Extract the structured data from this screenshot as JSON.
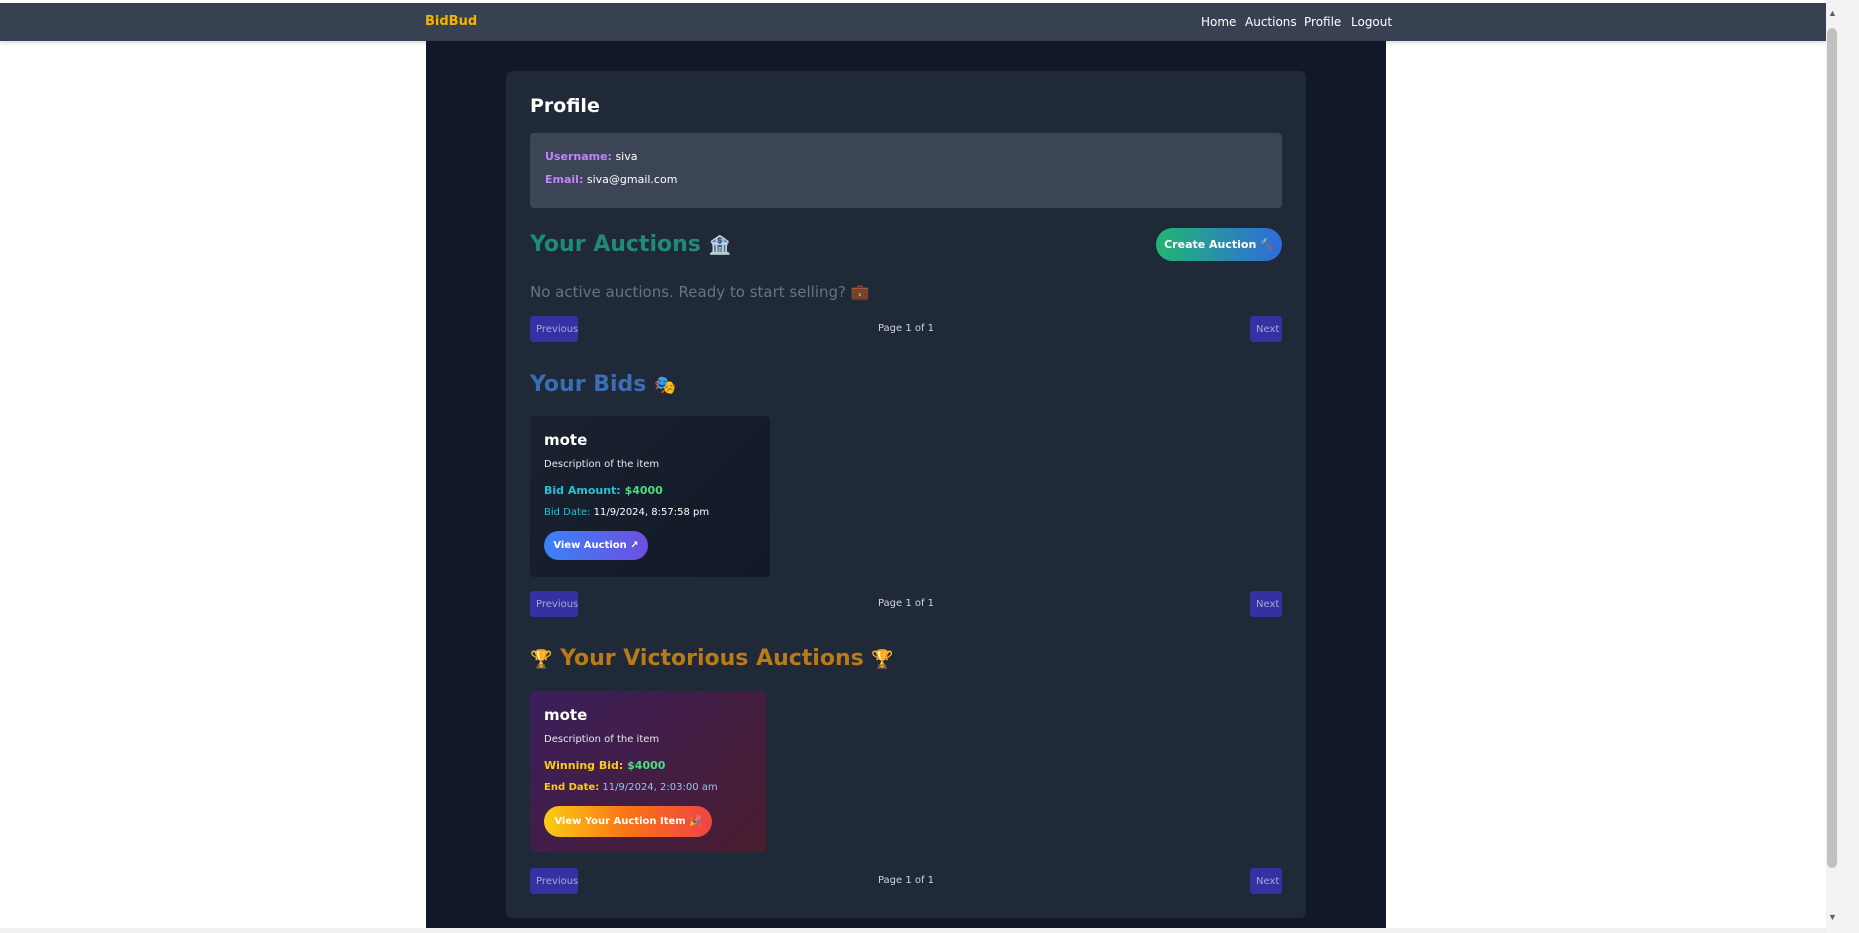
{
  "nav": {
    "brand": "BidBud",
    "links": [
      "Home",
      "Auctions",
      "Profile",
      "Logout"
    ]
  },
  "profile": {
    "title": "Profile",
    "username_label": "Username:",
    "username": "siva",
    "email_label": "Email:",
    "email": "siva@gmail.com"
  },
  "auctions": {
    "title": "Your Auctions",
    "emoji": "🏦",
    "create_label": "Create Auction",
    "create_emoji": "🔨",
    "empty_message": "No active auctions. Ready to start selling?",
    "empty_emoji": "💼",
    "pager": {
      "prev": "Previous",
      "text": "Page 1 of 1",
      "next": "Next"
    }
  },
  "bids": {
    "title": "Your Bids",
    "emoji": "🎭",
    "items": [
      {
        "name": "mote",
        "description": "Description of the item",
        "amount_label": "Bid Amount:",
        "amount": "$4000",
        "date_label": "Bid Date:",
        "date": "11/9/2024, 8:57:58 pm",
        "button": "View Auction",
        "button_emoji": "↗"
      }
    ],
    "pager": {
      "prev": "Previous",
      "text": "Page 1 of 1",
      "next": "Next"
    }
  },
  "victorious": {
    "title": "Your Victorious Auctions",
    "emoji": "🏆",
    "items": [
      {
        "name": "mote",
        "description": "Description of the item",
        "amount_label": "Winning Bid:",
        "amount": "$4000",
        "date_label": "End Date:",
        "date": "11/9/2024, 2:03:00 am",
        "button": "View Your Auction Item",
        "button_emoji": "🎉"
      }
    ],
    "pager": {
      "prev": "Previous",
      "text": "Page 1 of 1",
      "next": "Next"
    }
  },
  "colors": {
    "navbar": "#374151",
    "brand": "#f5b400",
    "page_bg": "#111827",
    "panel_bg": "#1f2937",
    "info_bg": "#3c4556",
    "pager_btn": "#3730a3"
  }
}
